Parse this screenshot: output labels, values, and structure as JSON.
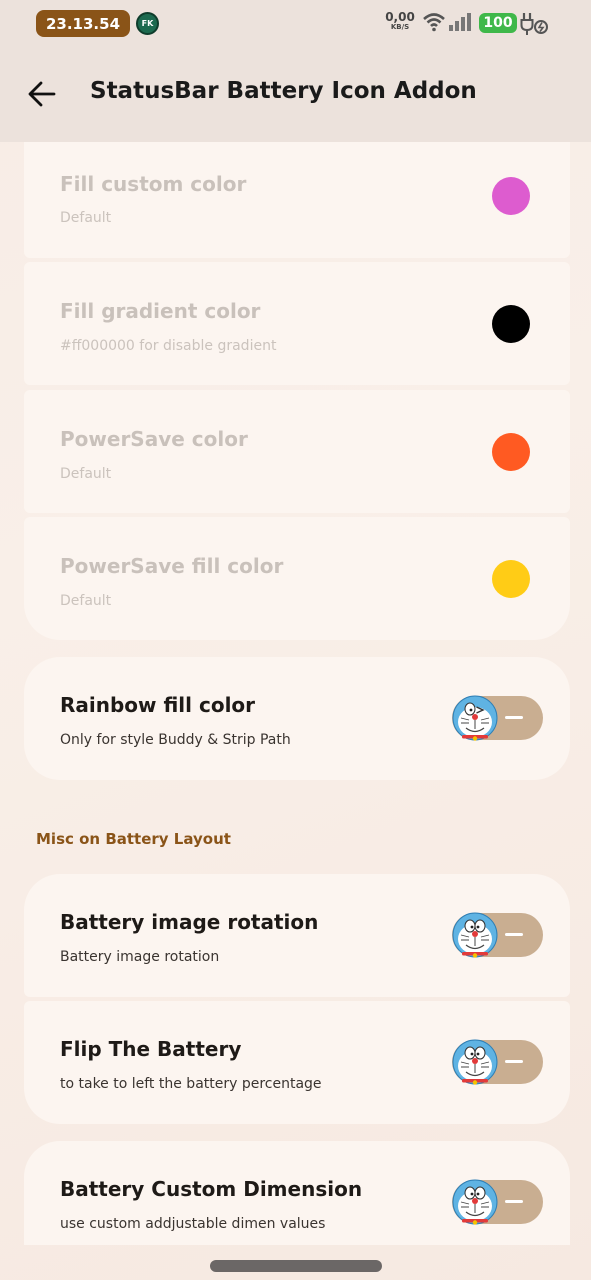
{
  "status_bar": {
    "time": "23.13.54",
    "app_badge": "FK",
    "net_speed_value": "0,00",
    "net_speed_unit": "KB/S",
    "battery_level": "100"
  },
  "app_bar": {
    "title": "StatusBar Battery Icon Addon"
  },
  "color_items": [
    {
      "title": "Fill custom color",
      "subtitle": "Default",
      "color": "#dd5ccf"
    },
    {
      "title": "Fill gradient color",
      "subtitle": "#ff000000 for disable gradient",
      "color": "#000000"
    },
    {
      "title": "PowerSave color",
      "subtitle": "Default",
      "color": "#ff5a22"
    },
    {
      "title": "PowerSave fill color",
      "subtitle": "Default",
      "color": "#ffcc16"
    }
  ],
  "rainbow_item": {
    "title": "Rainbow fill color",
    "subtitle": "Only for style Buddy & Strip Path",
    "enabled": false
  },
  "section": {
    "title": "Misc on Battery Layout"
  },
  "misc_items": [
    {
      "title": "Battery image rotation",
      "subtitle": "Battery image rotation",
      "enabled": false
    },
    {
      "title": "Flip The Battery",
      "subtitle": "to take to left the battery percentage",
      "enabled": false
    },
    {
      "title": "Battery Custom Dimension",
      "subtitle": "use custom addjustable dimen values",
      "enabled": false
    }
  ],
  "colors": {
    "accent": "#8a5418",
    "toggle_track_off": "#c9ae91",
    "battery_green": "#3fb84a"
  }
}
